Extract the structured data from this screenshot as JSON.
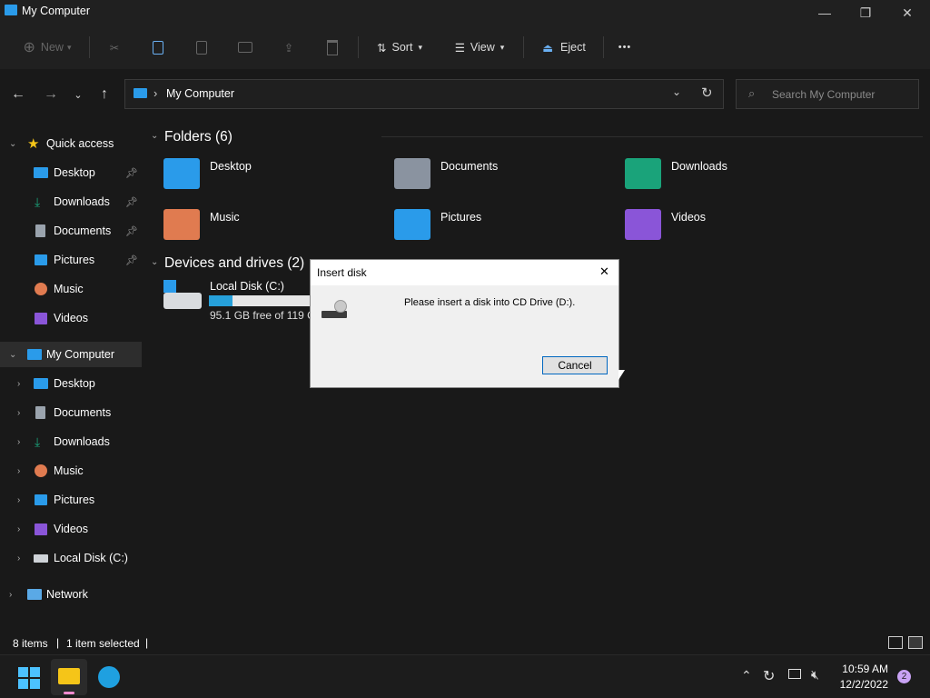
{
  "window": {
    "title": "My Computer",
    "minimize": "—",
    "maximize": "❐",
    "close": "✕"
  },
  "toolbar": {
    "new_label": "New",
    "sort_label": "Sort",
    "view_label": "View",
    "eject_label": "Eject",
    "more_label": "•••"
  },
  "address": {
    "path_label": "My Computer",
    "search_placeholder": "Search My Computer"
  },
  "sidebar": {
    "quick_access": "Quick access",
    "quick_items": [
      "Desktop",
      "Downloads",
      "Documents",
      "Pictures",
      "Music",
      "Videos"
    ],
    "my_computer": "My Computer",
    "pc_items": [
      "Desktop",
      "Documents",
      "Downloads",
      "Music",
      "Pictures",
      "Videos",
      "Local Disk (C:)"
    ],
    "network": "Network"
  },
  "main": {
    "folders_header": "Folders (6)",
    "folders": [
      "Desktop",
      "Documents",
      "Downloads",
      "Music",
      "Pictures",
      "Videos"
    ],
    "drives_header": "Devices and drives (2)",
    "drive": {
      "name": "Local Disk (C:)",
      "free_text": "95.1 GB free of 119 GB",
      "used_fraction": 0.2
    }
  },
  "status": {
    "items": "8 items",
    "selected": "1 item selected"
  },
  "dialog": {
    "title": "Insert disk",
    "message": "Please insert a disk into CD Drive (D:).",
    "cancel_label": "Cancel",
    "close": "✕"
  },
  "taskbar": {
    "time": "10:59 AM",
    "date": "12/2/2022",
    "notifications": "2"
  },
  "colors": {
    "accent": "#0078d4",
    "folder_blue": "#2a9bea",
    "folder_gray": "#8a93a0",
    "folder_green": "#1aa37a",
    "folder_orange": "#e07b50",
    "folder_purple": "#8a55d8"
  }
}
